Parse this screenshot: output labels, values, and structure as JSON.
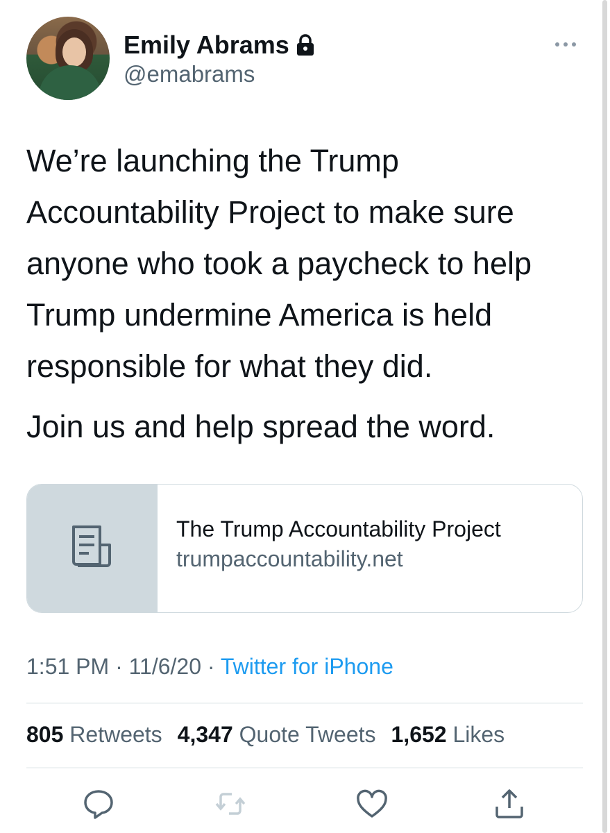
{
  "author": {
    "name": "Emily Abrams",
    "handle": "@emabrams",
    "protected_icon": "lock-icon"
  },
  "tweet": {
    "paragraph_1": "We’re launching the Trump\nAccountability Project to make sure\nanyone who took a paycheck to help\nTrump undermine America is held\nresponsible for what they did.",
    "paragraph_2": "Join us and help spread the word."
  },
  "link_card": {
    "title": "The Trump Accountability Project",
    "domain": "trumpaccountability.net",
    "icon": "document-icon"
  },
  "meta": {
    "time": "1:51 PM",
    "sep1": " · ",
    "date": "11/6/20",
    "sep2": " · ",
    "source": "Twitter for iPhone"
  },
  "stats": {
    "retweets_count": "805",
    "retweets_label": "Retweets",
    "quotes_count": "4,347",
    "quotes_label": "Quote Tweets",
    "likes_count": "1,652",
    "likes_label": "Likes"
  },
  "actions": [
    "reply-icon",
    "retweet-icon",
    "like-icon",
    "share-icon"
  ],
  "colors": {
    "text": "#0f1419",
    "secondary": "#536471",
    "link": "#1d9bf0",
    "border": "#cfd9de"
  }
}
